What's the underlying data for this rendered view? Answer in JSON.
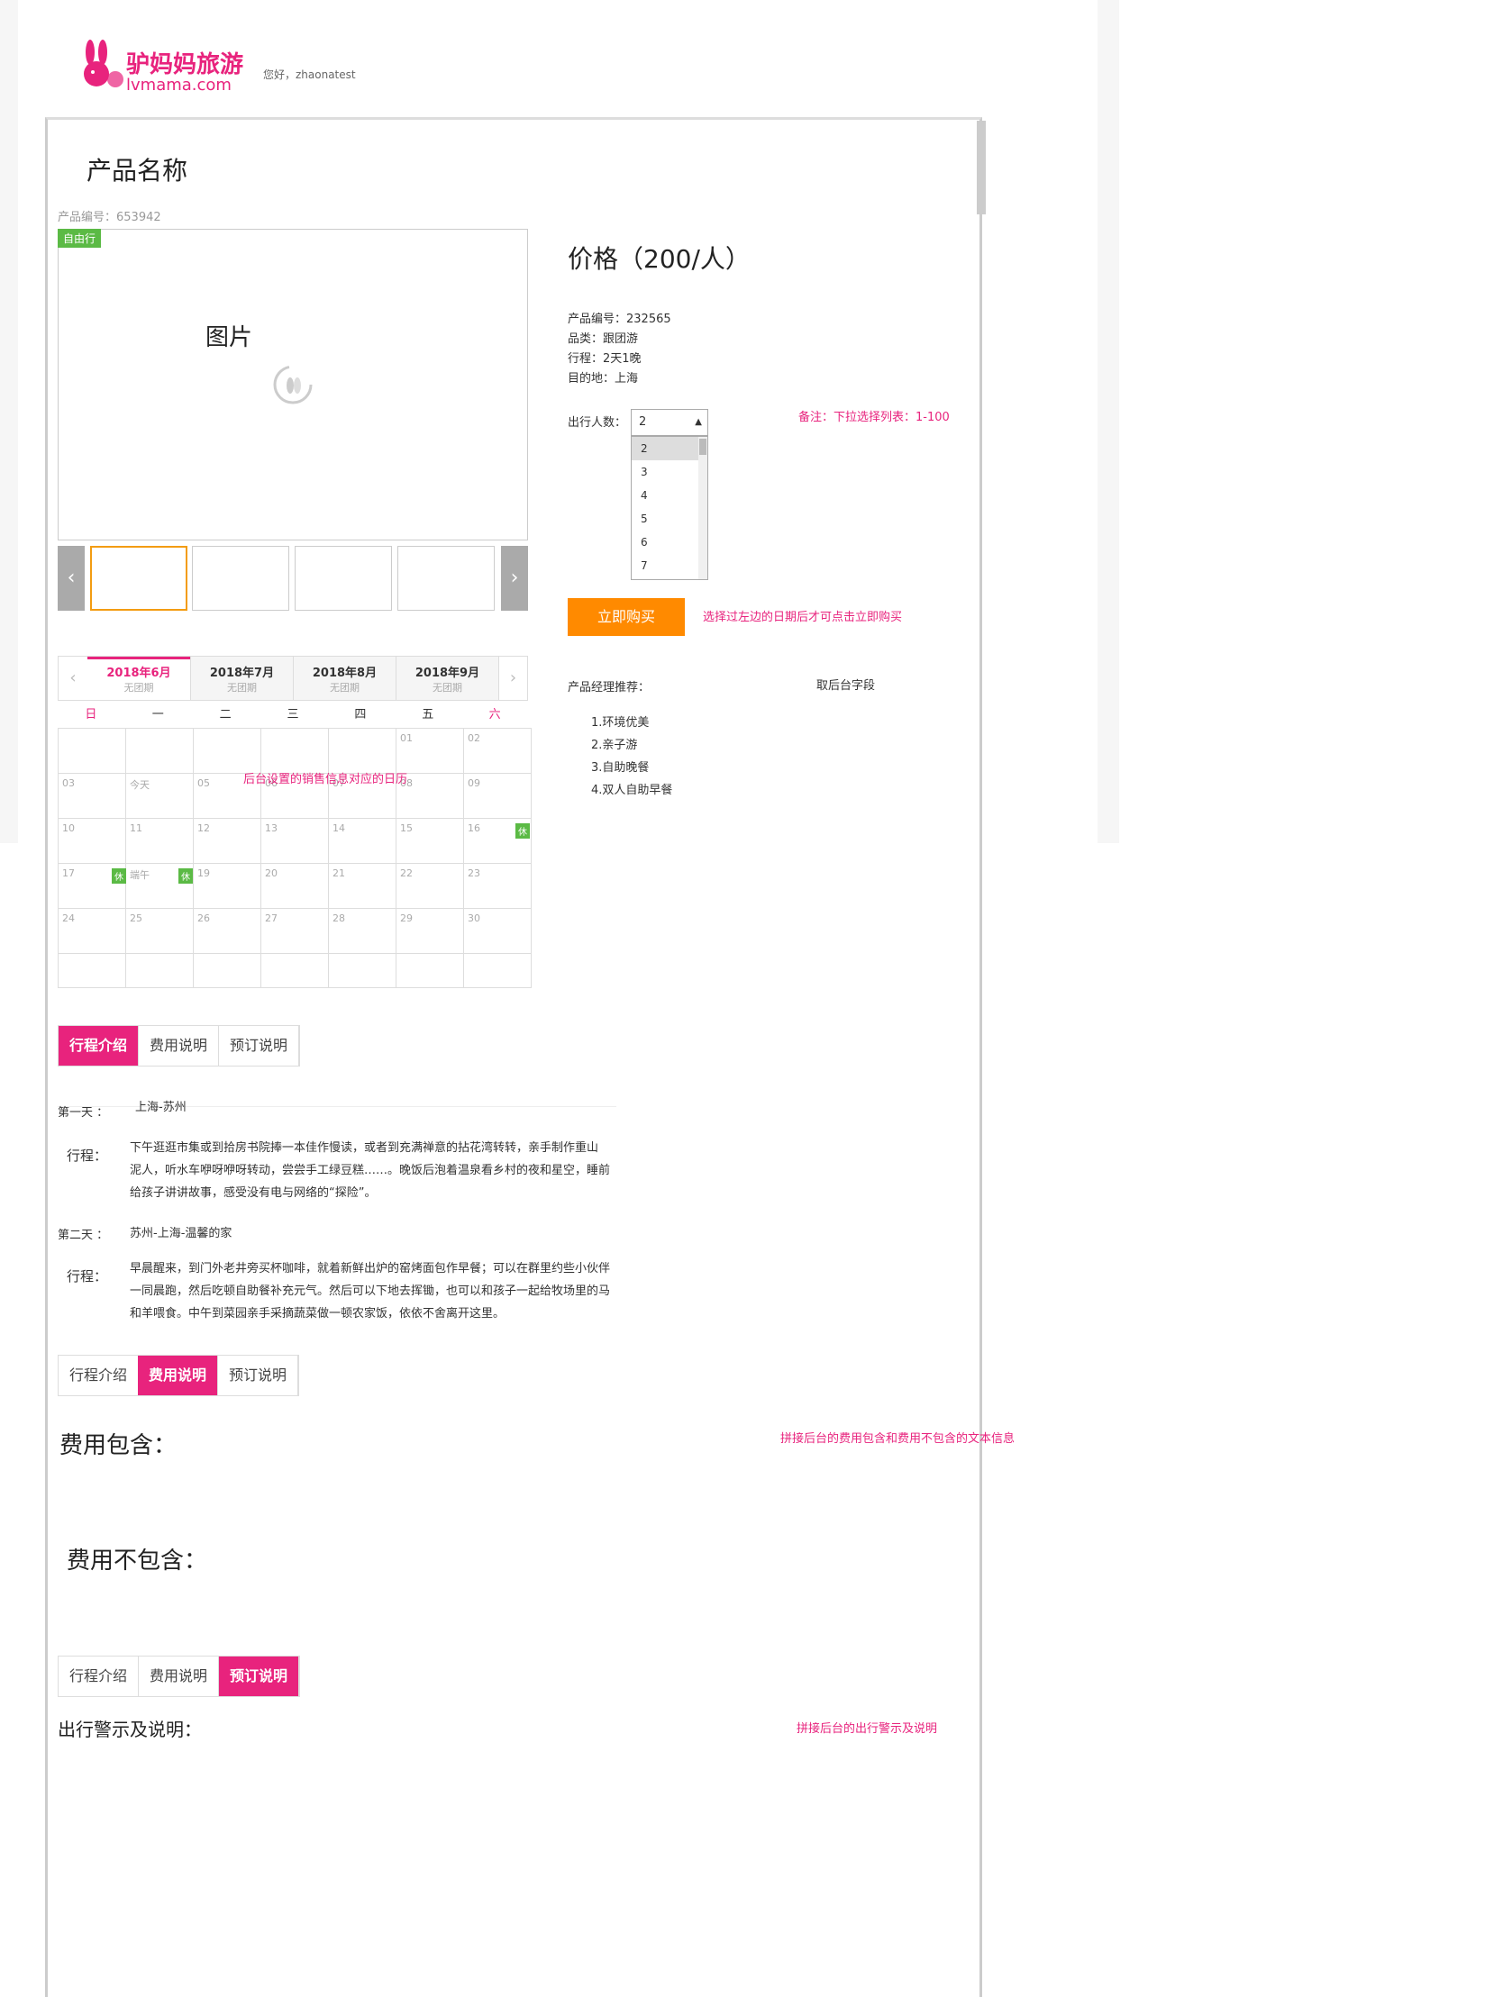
{
  "header": {
    "logo_title": "驴妈妈旅游",
    "logo_sub": "lvmama.com",
    "greeting": "您好，zhaonatest"
  },
  "product": {
    "title": "产品名称",
    "code_line": "产品编号：653942",
    "tag": "自由行",
    "image_placeholder": "图片",
    "price": "价格（200/人）",
    "info": [
      "产品编号：232565",
      "品类：跟团游",
      "行程：2天1晚",
      "目的地：上海"
    ],
    "travelers_label": "出行人数：",
    "travelers_selected": "2",
    "travelers_options": [
      "2",
      "3",
      "4",
      "5",
      "6",
      "7"
    ],
    "travelers_note": "备注：下拉选择列表：1-100",
    "buy_button": "立即购买",
    "buy_note": "选择过左边的日期后才可点击立即购买",
    "manager_label": "产品经理推荐：",
    "manager_field": "取后台字段",
    "recommends": [
      "1.环境优美",
      "2.亲子游",
      "3.自助晚餐",
      "4.双人自助早餐"
    ]
  },
  "calendar": {
    "months": [
      {
        "name": "2018年6月",
        "sub": "无团期"
      },
      {
        "name": "2018年7月",
        "sub": "无团期"
      },
      {
        "name": "2018年8月",
        "sub": "无团期"
      },
      {
        "name": "2018年9月",
        "sub": "无团期"
      }
    ],
    "weekdays": [
      "日",
      "一",
      "二",
      "三",
      "四",
      "五",
      "六"
    ],
    "note": "后台设置的销售信息对应的日历",
    "weeks": [
      [
        "",
        "",
        "",
        "",
        "",
        "01",
        "02"
      ],
      [
        "03",
        "今天",
        "05",
        "06",
        "07",
        "08",
        "09"
      ],
      [
        "10",
        "11",
        "12",
        "13",
        "14",
        "15",
        "16"
      ],
      [
        "17",
        "端午",
        "19",
        "20",
        "21",
        "22",
        "23"
      ],
      [
        "24",
        "25",
        "26",
        "27",
        "28",
        "29",
        "30"
      ],
      [
        "",
        "",
        "",
        "",
        "",
        "",
        ""
      ]
    ],
    "holiday_badge": "休"
  },
  "tabs": [
    "行程介绍",
    "费用说明",
    "预订说明"
  ],
  "itinerary": {
    "day1_label": "第一天 ：",
    "day1_route": "上海-苏州",
    "day2_label": "第二天 ：",
    "day2_route": "苏州-上海-温馨的家",
    "trip_label": "行程：",
    "day1_lines": [
      "下午逛逛市集或到拾房书院捧一本佳作慢读，或者到充满禅意的拈花湾转转，亲手制作重山",
      "泥人，听水车咿呀咿呀转动，尝尝手工绿豆糕……。晚饭后泡着温泉看乡村的夜和星空，睡前",
      "给孩子讲讲故事，感受没有电与网络的“探险”。"
    ],
    "day2_lines": [
      "早晨醒来，到门外老井旁买杯咖啡，就着新鲜出炉的窑烤面包作早餐；可以在群里约些小伙伴",
      "一同晨跑，然后吃顿自助餐补充元气。然后可以下地去挥锄，也可以和孩子一起给牧场里的马",
      "和羊喂食。中午到菜园亲手采摘蔬菜做一顿农家饭，依依不舍离开这里。"
    ]
  },
  "fees": {
    "included": "费用包含：",
    "excluded": "费用不包含：",
    "note": "拼接后台的费用包含和费用不包含的文本信息"
  },
  "booking": {
    "title": "出行警示及说明：",
    "note": "拼接后台的出行警示及说明"
  }
}
